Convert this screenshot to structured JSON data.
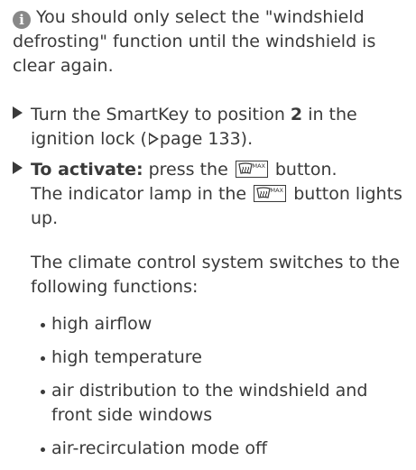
{
  "note": {
    "icon": "info-icon",
    "text": "You should only select the \"windshield defrosting\" function until the windshield is clear again."
  },
  "steps": [
    {
      "text_before": "Turn the SmartKey to position ",
      "bold": "2",
      "text_after": " in the ignition lock (",
      "page_ref": "page 133",
      "text_end": ")."
    },
    {
      "bold_label": "To activate:",
      "text_before_button": " press the ",
      "button_icon": "windshield-defrost-max-icon",
      "button_text": "MAX",
      "text_after_button": " button.",
      "line2_before": "The indicator lamp in the ",
      "line2_after": " button lights up."
    }
  ],
  "paragraph": "The climate control system switches to the following functions:",
  "functions": [
    "high airflow",
    "high temperature",
    "air distribution to the windshield and front side windows",
    "air-recirculation mode off"
  ]
}
